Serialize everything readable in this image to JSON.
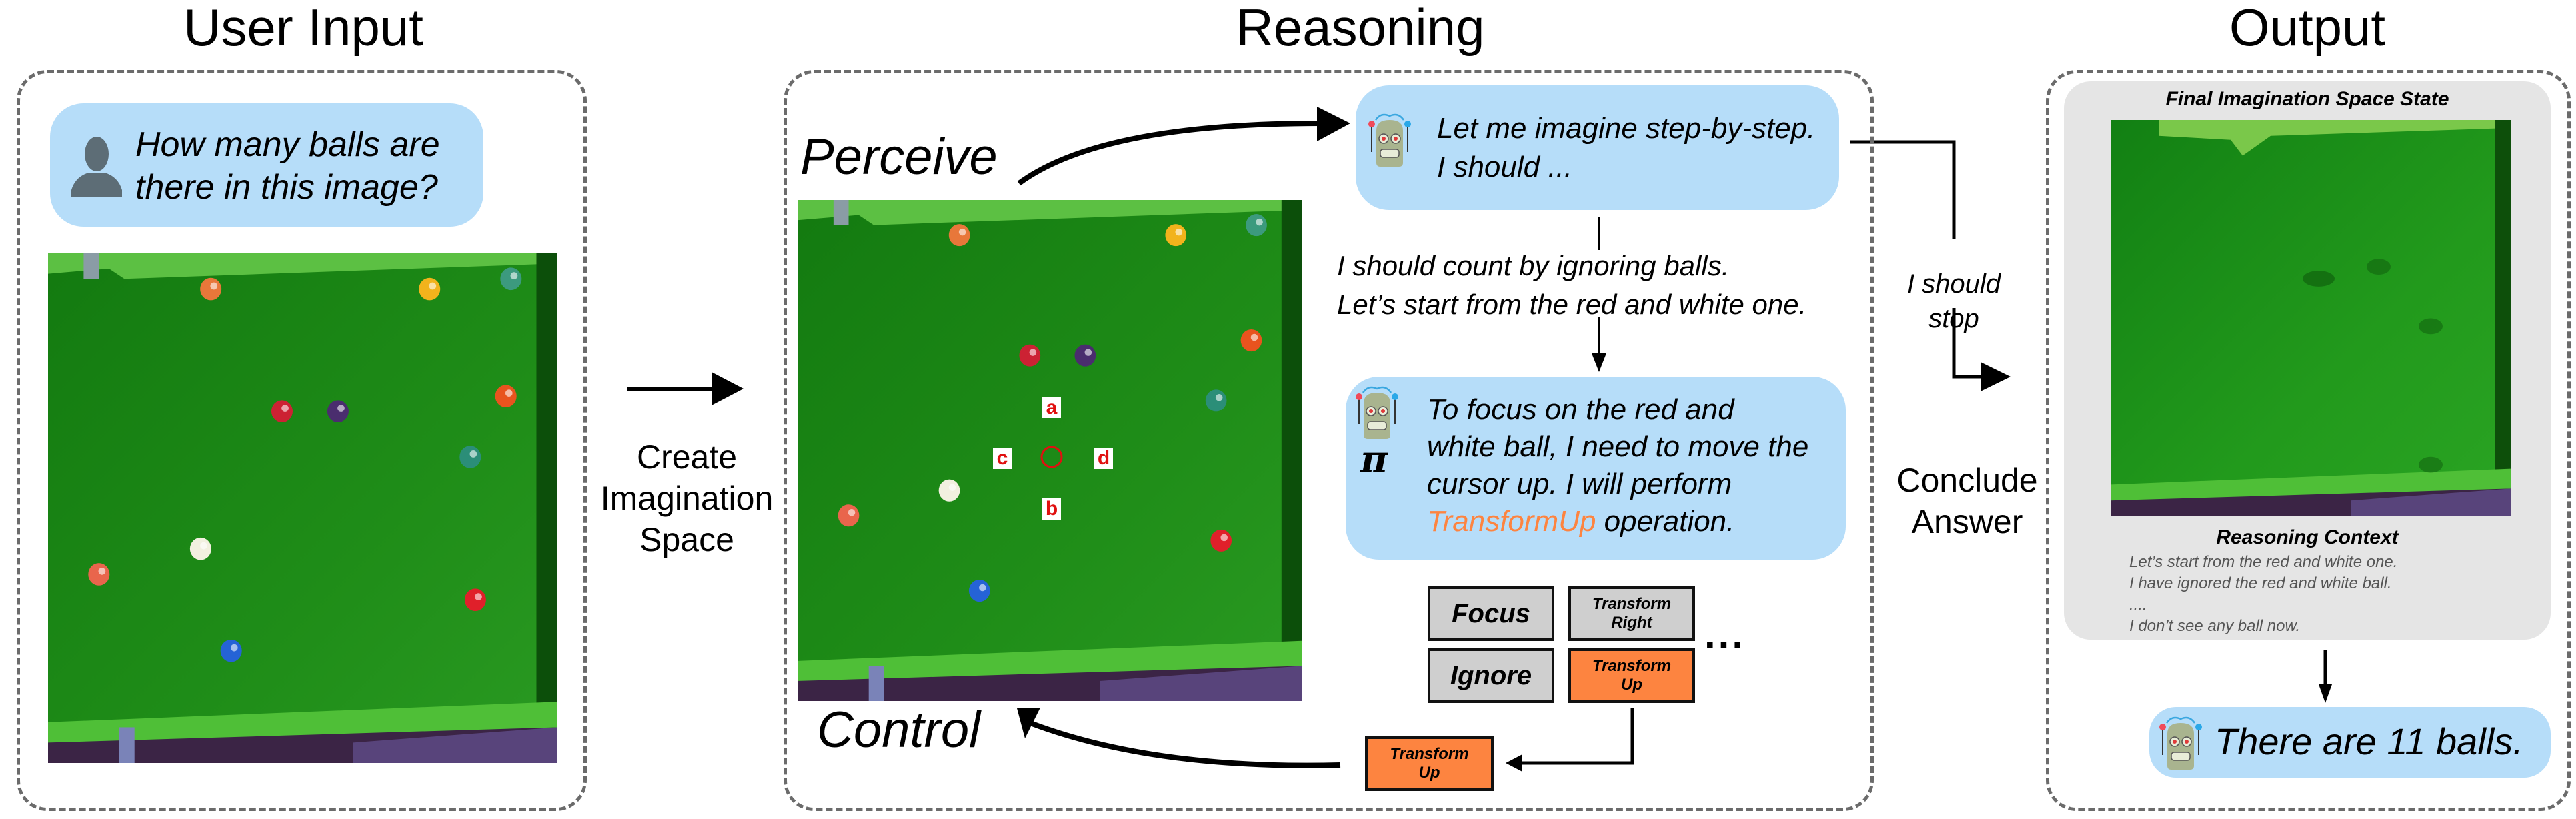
{
  "sections": {
    "user_input": {
      "title": "User Input"
    },
    "reasoning": {
      "title": "Reasoning"
    },
    "output": {
      "title": "Output"
    }
  },
  "user_input": {
    "question_lines": [
      "How many balls are",
      "there in this image?"
    ],
    "avatar_icon": "user-silhouette-icon",
    "image_description": "Overhead view of a green pool table with 11 balls"
  },
  "transitions": {
    "create_space": [
      "Create",
      "Imagination",
      "Space"
    ],
    "conclude": [
      "Conclude",
      "Answer"
    ],
    "stop_label": [
      "I should",
      "stop"
    ]
  },
  "reasoning": {
    "perceive_label": "Perceive",
    "control_label": "Control",
    "bubble1_lines": [
      "Let me imagine step-by-step.",
      "I should ..."
    ],
    "middle_lines": [
      "I should count by ignoring balls.",
      "Let’s start from the red and white one."
    ],
    "bubble2": {
      "lines": [
        "To focus on the red and",
        "white ball, I need to move the",
        "cursor up. I will perform"
      ],
      "highlight": "TransformUp",
      "tail": " operation.",
      "policy_symbol": "π"
    },
    "cursor_labels": {
      "up": "a",
      "down": "b",
      "left": "c",
      "right": "d"
    },
    "operations": [
      {
        "line1": "Focus",
        "line2": "",
        "selected": false
      },
      {
        "line1": "Transform",
        "line2": "Right",
        "selected": false
      },
      {
        "line1": "Ignore",
        "line2": "",
        "selected": false
      },
      {
        "line1": "Transform",
        "line2": "Up",
        "selected": true
      }
    ],
    "more_ops": "...",
    "chosen_op": {
      "line1": "Transform",
      "line2": "Up"
    }
  },
  "output": {
    "final_state_title": "Final Imagination Space State",
    "context_title": "Reasoning Context",
    "context_lines": [
      "Let’s start from the red and white one.",
      "I have ignored the red and white ball.",
      "....",
      "I don’t see any ball now."
    ],
    "answer": "There are 11 balls."
  },
  "colors": {
    "bubble_blue": "#b6ddf9",
    "highlight_orange": "#fd8440",
    "op_gray": "#cfcfcf",
    "context_gray": "#e5e5e5",
    "panel_border": "#6b6b6b",
    "cursor_red": "#e01010"
  }
}
